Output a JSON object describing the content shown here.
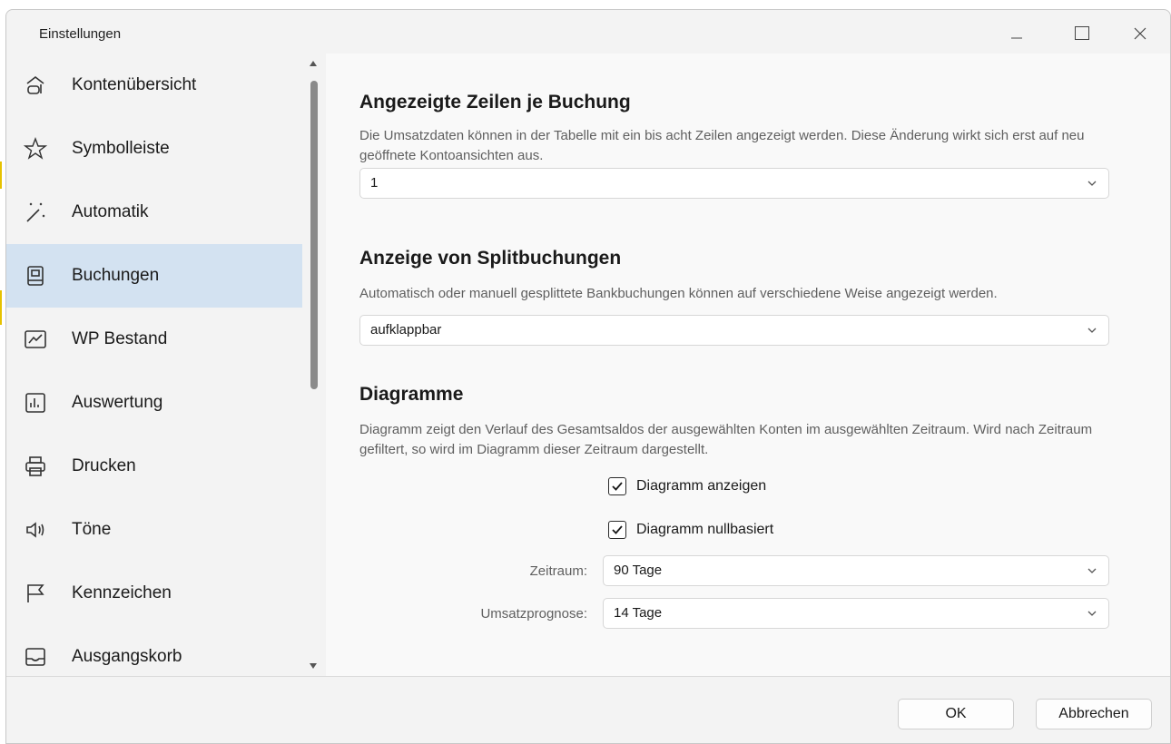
{
  "window": {
    "title": "Einstellungen"
  },
  "sidebar": {
    "items": [
      {
        "label": "Kontenübersicht",
        "icon": "bank-icon"
      },
      {
        "label": "Symbolleiste",
        "icon": "star-icon"
      },
      {
        "label": "Automatik",
        "icon": "magic-wand-icon"
      },
      {
        "label": "Buchungen",
        "icon": "book-icon",
        "active": true
      },
      {
        "label": "WP Bestand",
        "icon": "chart-line-icon"
      },
      {
        "label": "Auswertung",
        "icon": "bar-chart-icon"
      },
      {
        "label": "Drucken",
        "icon": "printer-icon"
      },
      {
        "label": "Töne",
        "icon": "speaker-icon"
      },
      {
        "label": "Kennzeichen",
        "icon": "flag-icon"
      },
      {
        "label": "Ausgangskorb",
        "icon": "inbox-icon"
      }
    ]
  },
  "main": {
    "rows": {
      "title": "Angezeigte Zeilen je Buchung",
      "description": "Die Umsatzdaten können in der Tabelle mit ein bis acht Zeilen angezeigt werden. Diese Änderung wirkt sich erst auf neu geöffnete Kontoansichten aus.",
      "value": "1"
    },
    "split": {
      "title": "Anzeige von Splitbuchungen",
      "description": "Automatisch oder manuell gesplittete Bankbuchungen können auf verschiedene Weise angezeigt werden.",
      "value": "aufklappbar"
    },
    "chart": {
      "title": "Diagramme",
      "description": "Diagramm zeigt den Verlauf des Gesamtsaldos der ausgewählten Konten im ausgewählten Zeitraum. Wird nach Zeitraum gefiltert, so wird im Diagramm dieser Zeitraum dargestellt.",
      "show_label": "Diagramm anzeigen",
      "show_checked": true,
      "zero_label": "Diagramm nullbasiert",
      "zero_checked": true,
      "period_label": "Zeitraum:",
      "period_value": "90 Tage",
      "forecast_label": "Umsatzprognose:",
      "forecast_value": "14 Tage"
    }
  },
  "footer": {
    "ok_label": "OK",
    "cancel_label": "Abbrechen"
  }
}
